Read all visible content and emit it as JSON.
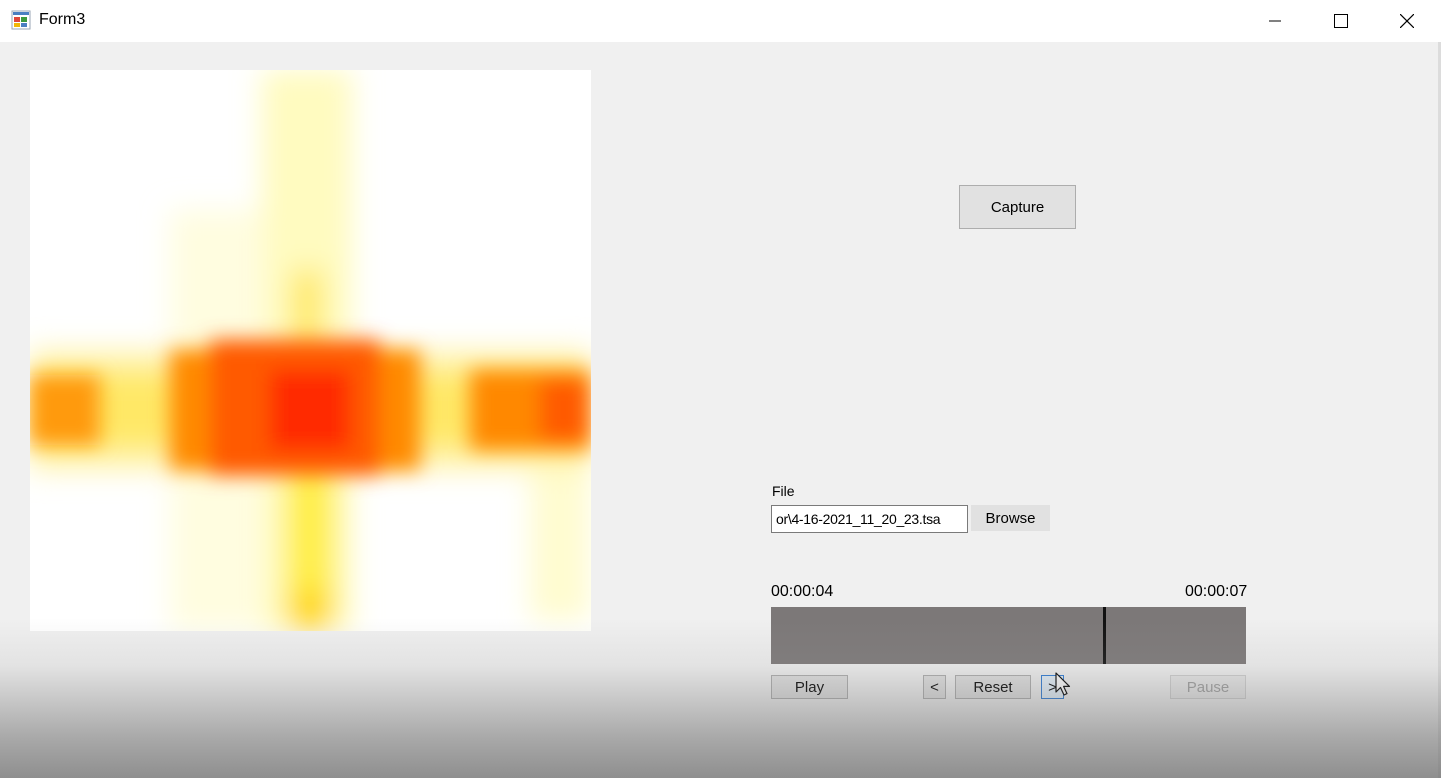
{
  "window": {
    "title": "Form3",
    "icon": "windows-form-icon",
    "controls": [
      "minimize-icon",
      "maximize-icon",
      "close-icon"
    ]
  },
  "heatmap": {
    "description_icon": "heatmap-image",
    "colors": {
      "hot": "#ff2a00",
      "mid": "#ffcc00",
      "cool": "#ffffb0",
      "background": "#ffffff"
    }
  },
  "capture_button": {
    "label": "Capture"
  },
  "file": {
    "label": "File",
    "value": "or\\4-16-2021_11_20_23.tsa",
    "browse_label": "Browse"
  },
  "playback": {
    "time_current": "00:00:04",
    "time_total": "00:00:07",
    "position_fraction": 0.7,
    "play_label": "Play",
    "prev_label": "<",
    "reset_label": "Reset",
    "next_label": ">",
    "pause_label": "Pause"
  },
  "colors": {
    "track": "#7c7878",
    "button": "#e1e1e1",
    "focus": "#2b7ad6"
  }
}
